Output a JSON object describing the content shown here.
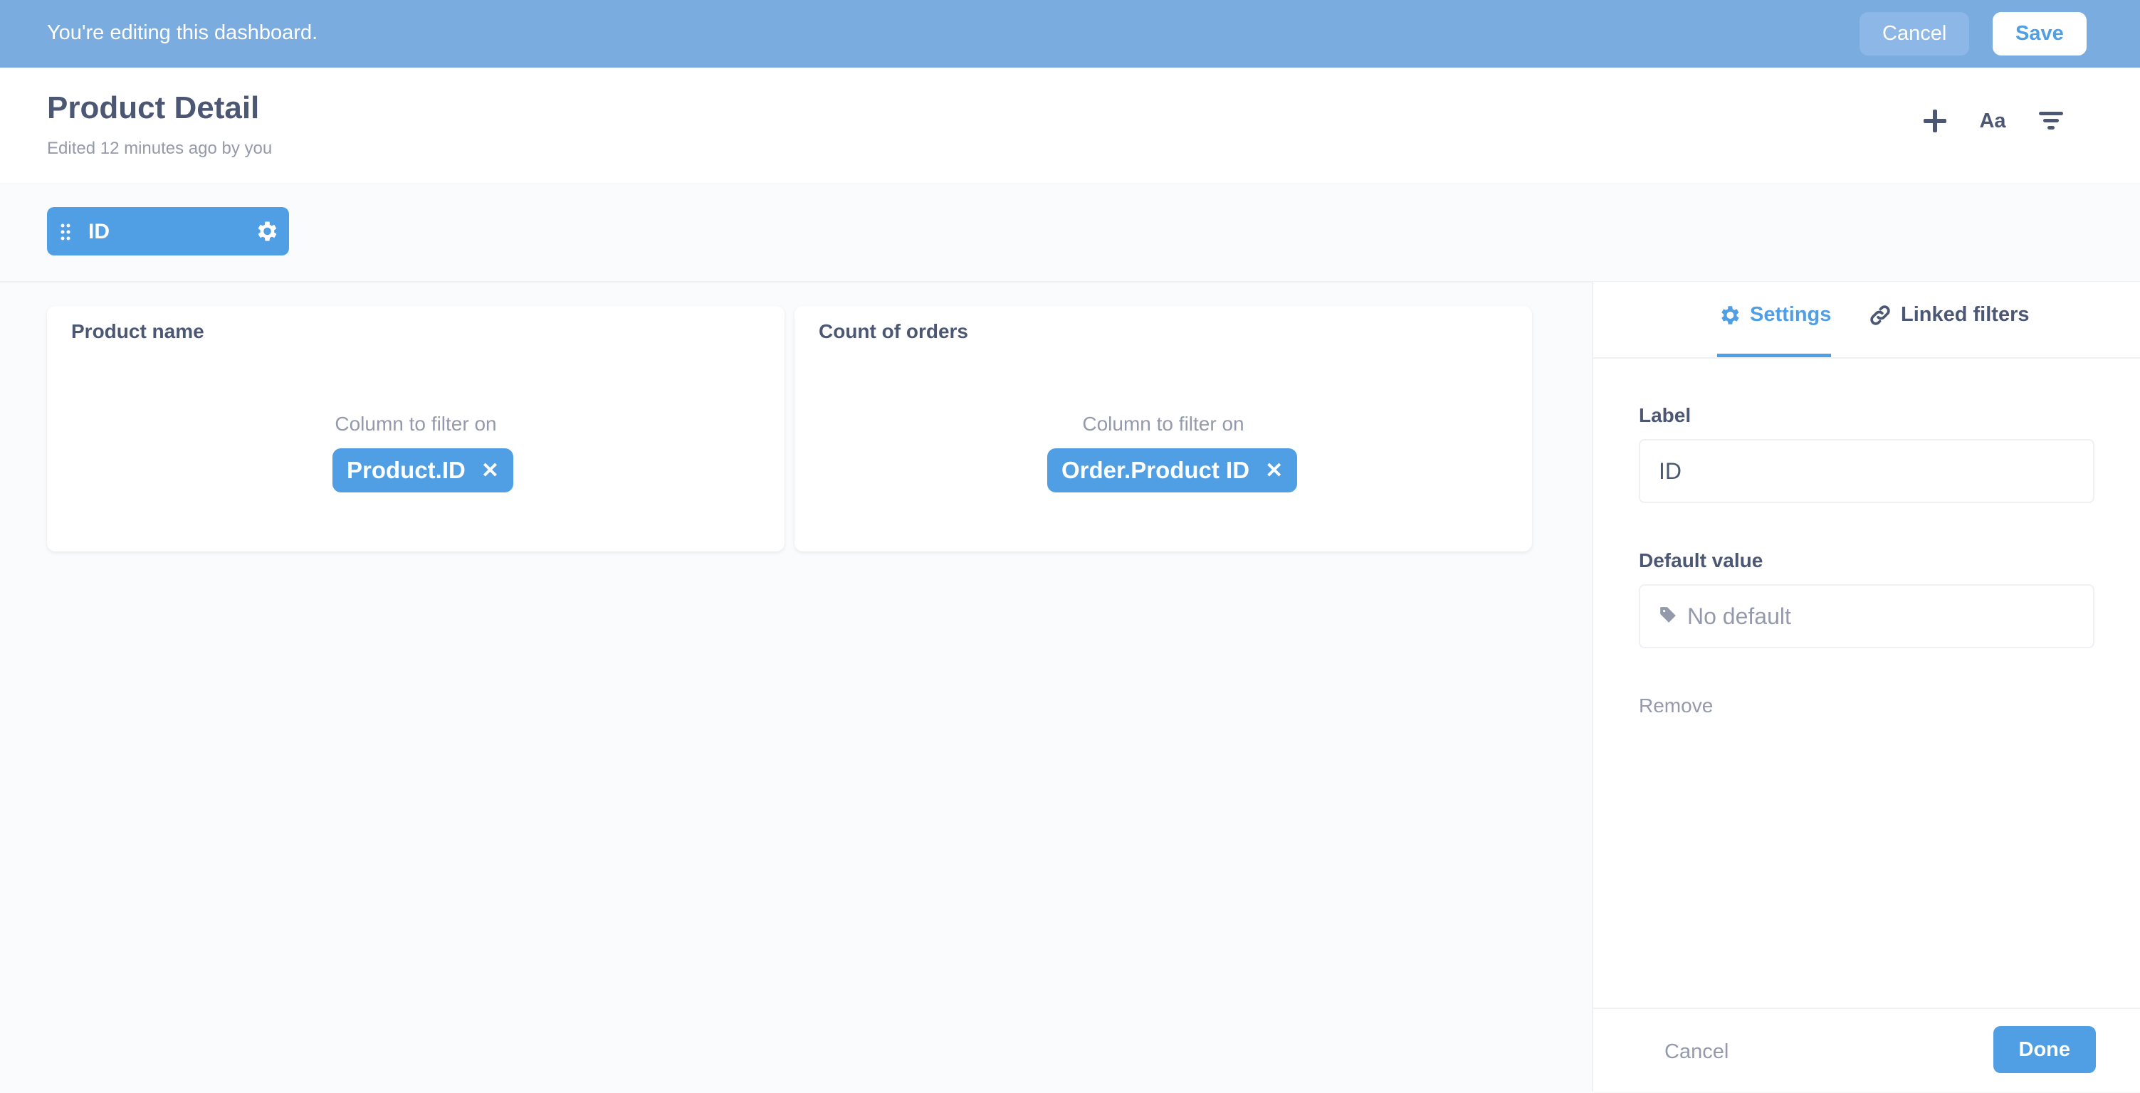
{
  "edit_banner": {
    "message": "You're editing this dashboard.",
    "cancel_label": "Cancel",
    "save_label": "Save"
  },
  "header": {
    "title": "Product Detail",
    "subtitle": "Edited 12 minutes ago by you",
    "icons": [
      "add-icon",
      "text-icon",
      "filter-icon"
    ],
    "text_icon_label": "Aa"
  },
  "filter_chip": {
    "label": "ID"
  },
  "cards": [
    {
      "title": "Product name",
      "filter_caption": "Column to filter on",
      "column": "Product.ID"
    },
    {
      "title": "Count of orders",
      "filter_caption": "Column to filter on",
      "column": "Order.Product ID"
    }
  ],
  "sidebar": {
    "tabs": [
      {
        "label": "Settings",
        "icon": "gear-icon",
        "active": true
      },
      {
        "label": "Linked filters",
        "icon": "link-icon",
        "active": false
      }
    ],
    "label_field": {
      "label": "Label",
      "value": "ID"
    },
    "default_field": {
      "label": "Default value",
      "placeholder": "No default"
    },
    "remove_label": "Remove",
    "cancel_label": "Cancel",
    "done_label": "Done"
  },
  "colors": {
    "banner": "#7aace0",
    "brand": "#509ee3",
    "text": "#4c5773",
    "muted": "#949aab"
  }
}
